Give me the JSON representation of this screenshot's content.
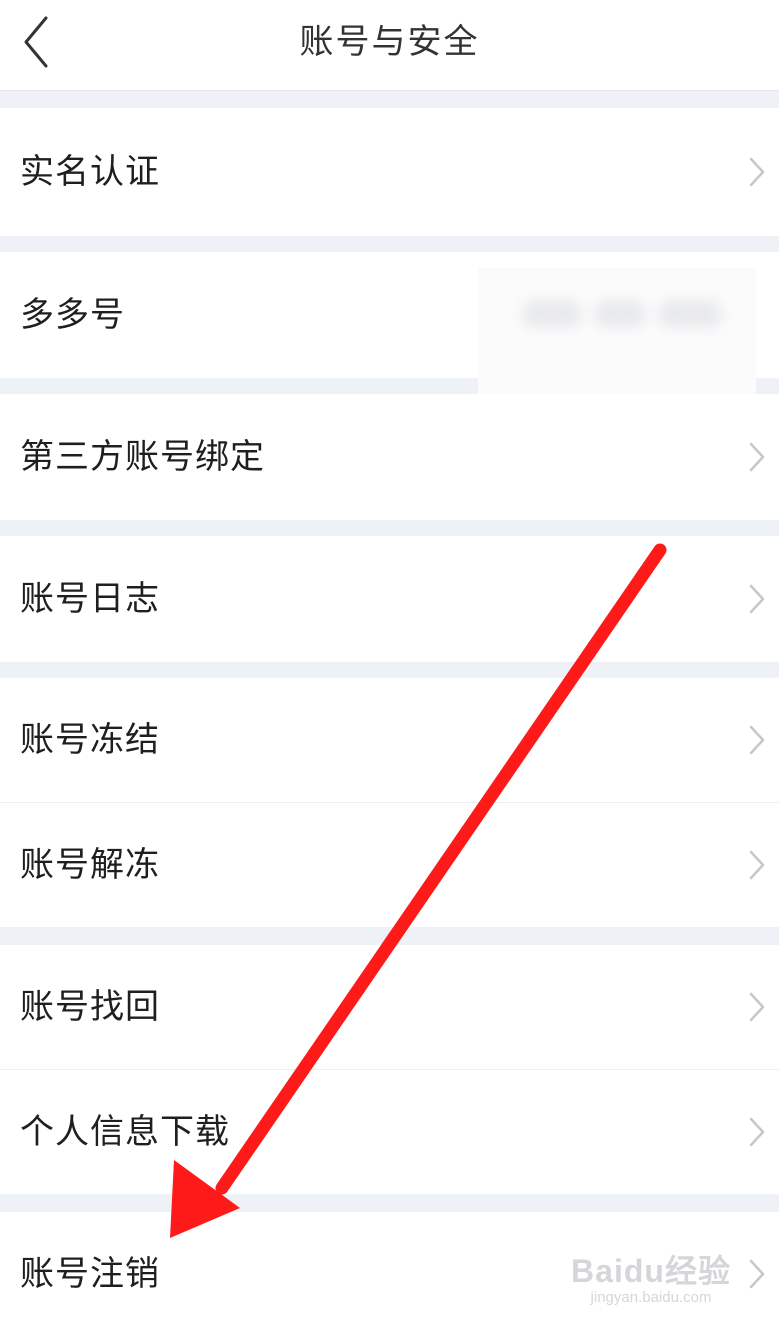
{
  "header": {
    "title": "账号与安全",
    "back_icon": "chevron-left-icon"
  },
  "menu": {
    "items": [
      {
        "label": "实名认证",
        "icon": "chevron-right-icon"
      },
      {
        "label": "多多号",
        "value": ""
      },
      {
        "label": "第三方账号绑定",
        "icon": "chevron-right-icon"
      },
      {
        "label": "账号日志",
        "icon": "chevron-right-icon"
      },
      {
        "label": "账号冻结",
        "icon": "chevron-right-icon"
      },
      {
        "label": "账号解冻",
        "icon": "chevron-right-icon"
      },
      {
        "label": "账号找回",
        "icon": "chevron-right-icon"
      },
      {
        "label": "个人信息下载",
        "icon": "chevron-right-icon"
      },
      {
        "label": "账号注销",
        "icon": "chevron-right-icon"
      }
    ]
  },
  "annotation": {
    "arrow_color": "#ff1a1a"
  },
  "watermark": {
    "brand": "Baidu经验",
    "url": "jingyan.baidu.com"
  }
}
